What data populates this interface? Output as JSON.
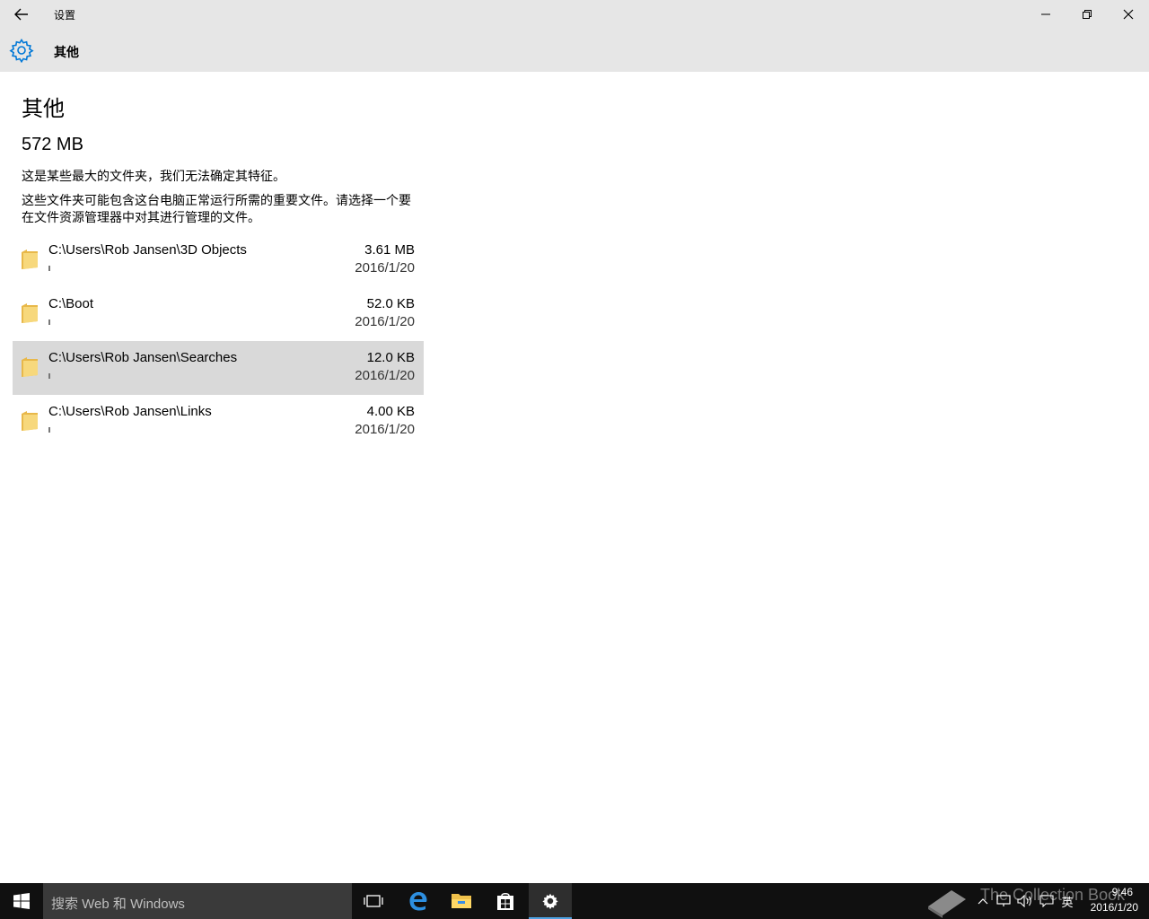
{
  "titlebar": {
    "title": "设置",
    "back_icon": "back-arrow-icon",
    "minimize_icon": "minimize-icon",
    "restore_icon": "restore-icon",
    "close_icon": "close-icon"
  },
  "header": {
    "icon": "gear-icon",
    "title": "其他",
    "accent": "#0078d7"
  },
  "main": {
    "title": "其他",
    "total_size": "572 MB",
    "description1": "这是某些最大的文件夹，我们无法确定其特征。",
    "description2": "这些文件夹可能包含这台电脑正常运行所需的重要文件。请选择一个要在文件资源管理器中对其进行管理的文件。",
    "folders": [
      {
        "path": "C:\\Users\\Rob Jansen\\3D Objects",
        "size": "3.61 MB",
        "date": "2016/1/20",
        "selected": false
      },
      {
        "path": "C:\\Boot",
        "size": "52.0 KB",
        "date": "2016/1/20",
        "selected": false
      },
      {
        "path": "C:\\Users\\Rob Jansen\\Searches",
        "size": "12.0 KB",
        "date": "2016/1/20",
        "selected": true
      },
      {
        "path": "C:\\Users\\Rob Jansen\\Links",
        "size": "4.00 KB",
        "date": "2016/1/20",
        "selected": false
      }
    ]
  },
  "taskbar": {
    "search_placeholder": "搜索 Web 和 Windows",
    "apps": [
      "task-view-icon",
      "edge-icon",
      "file-explorer-icon",
      "store-icon",
      "settings-icon"
    ],
    "active_app": "settings-icon",
    "ime": "英",
    "clock_time": "9:46",
    "clock_date": "2016/1/20",
    "watermark": "The Collection Book"
  }
}
